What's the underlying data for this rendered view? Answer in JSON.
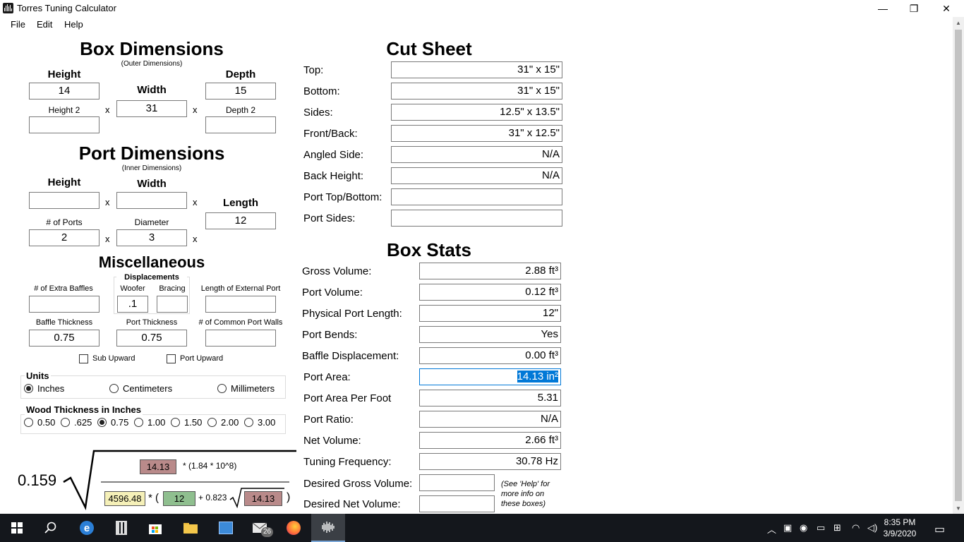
{
  "window": {
    "title": "Torres Tuning Calculator",
    "minimize": "—",
    "maximize": "❐",
    "close": "✕"
  },
  "menu": [
    "File",
    "Edit",
    "Help"
  ],
  "box_dimensions": {
    "title": "Box Dimensions",
    "subtitle": "(Outer Dimensions)",
    "height_label": "Height",
    "height": "14",
    "width_label": "Width",
    "width": "31",
    "depth_label": "Depth",
    "depth": "15",
    "height2_label": "Height 2",
    "height2": "",
    "depth2_label": "Depth 2",
    "depth2": "",
    "x": "x"
  },
  "port_dimensions": {
    "title": "Port Dimensions",
    "subtitle": "(Inner Dimensions)",
    "height_label": "Height",
    "height": "",
    "width_label": "Width",
    "width": "",
    "length_label": "Length",
    "length": "12",
    "ports_label": "# of Ports",
    "ports": "2",
    "diameter_label": "Diameter",
    "diameter": "3"
  },
  "misc": {
    "title": "Miscellaneous",
    "extra_baffles_label": "# of Extra Baffles",
    "extra_baffles": "",
    "displacements_label": "Displacements",
    "woofer_label": "Woofer",
    "woofer": ".1",
    "bracing_label": "Bracing",
    "bracing": "",
    "ext_port_label": "Length of External Port",
    "ext_port": "",
    "baffle_thickness_label": "Baffle Thickness",
    "baffle_thickness": "0.75",
    "port_thickness_label": "Port Thickness",
    "port_thickness": "0.75",
    "common_walls_label": "# of Common Port Walls",
    "common_walls": "",
    "sub_upward_label": "Sub Upward",
    "port_upward_label": "Port Upward"
  },
  "units": {
    "title": "Units",
    "options": [
      "Inches",
      "Centimeters",
      "Millimeters"
    ],
    "selected": "Inches"
  },
  "wood": {
    "title": "Wood Thickness in Inches",
    "options": [
      "0.50",
      ".625",
      "0.75",
      "1.00",
      "1.50",
      "2.00",
      "3.00"
    ],
    "selected": "0.75"
  },
  "formula": {
    "constant": "0.159",
    "area": "14.13",
    "factor": "* (1.84 * 10^8)",
    "volume": "4596.48",
    "star_paren": "* (",
    "length": "12",
    "plus": "+ 0.823",
    "area2": "14.13",
    "close": ")"
  },
  "cut_sheet": {
    "title": "Cut Sheet",
    "rows": [
      {
        "label": "Top:",
        "value": "31\" x 15\""
      },
      {
        "label": "Bottom:",
        "value": "31\" x 15\""
      },
      {
        "label": "Sides:",
        "value": "12.5\" x 13.5\""
      },
      {
        "label": "Front/Back:",
        "value": "31\" x 12.5\""
      },
      {
        "label": "Angled Side:",
        "value": "N/A"
      },
      {
        "label": "Back Height:",
        "value": "N/A"
      },
      {
        "label": "Port Top/Bottom:",
        "value": ""
      },
      {
        "label": "Port Sides:",
        "value": ""
      }
    ]
  },
  "box_stats": {
    "title": "Box Stats",
    "rows": [
      {
        "label": "Gross Volume:",
        "value": "2.88 ft³"
      },
      {
        "label": "Port Volume:",
        "value": "0.12 ft³"
      },
      {
        "label": "Physical Port Length:",
        "value": "12\""
      },
      {
        "label": "Port Bends:",
        "value": "Yes"
      },
      {
        "label": "Baffle Displacement:",
        "value": "0.00 ft³"
      },
      {
        "label": "Port Area:",
        "value": "14.13 in²"
      },
      {
        "label": "Port Area Per Foot",
        "value": "5.31"
      },
      {
        "label": "Port Ratio:",
        "value": "N/A"
      },
      {
        "label": "Net Volume:",
        "value": "2.66 ft³"
      },
      {
        "label": "Tuning Frequency:",
        "value": "30.78 Hz"
      }
    ],
    "desired_gross_label": "Desired Gross Volume:",
    "desired_gross": "",
    "desired_net_label": "Desired Net Volume:",
    "desired_net": "",
    "help_note": "(See 'Help' for more info on these boxes)"
  },
  "taskbar": {
    "mail_badge": "26",
    "time": "8:35 PM",
    "date": "3/9/2020"
  },
  "colors": {
    "area_box": "#b98a8a",
    "volume_box": "#f5f0b8",
    "length_box": "#8fbf8f",
    "selection": "#0078d7",
    "taskbar": "#14171c"
  }
}
